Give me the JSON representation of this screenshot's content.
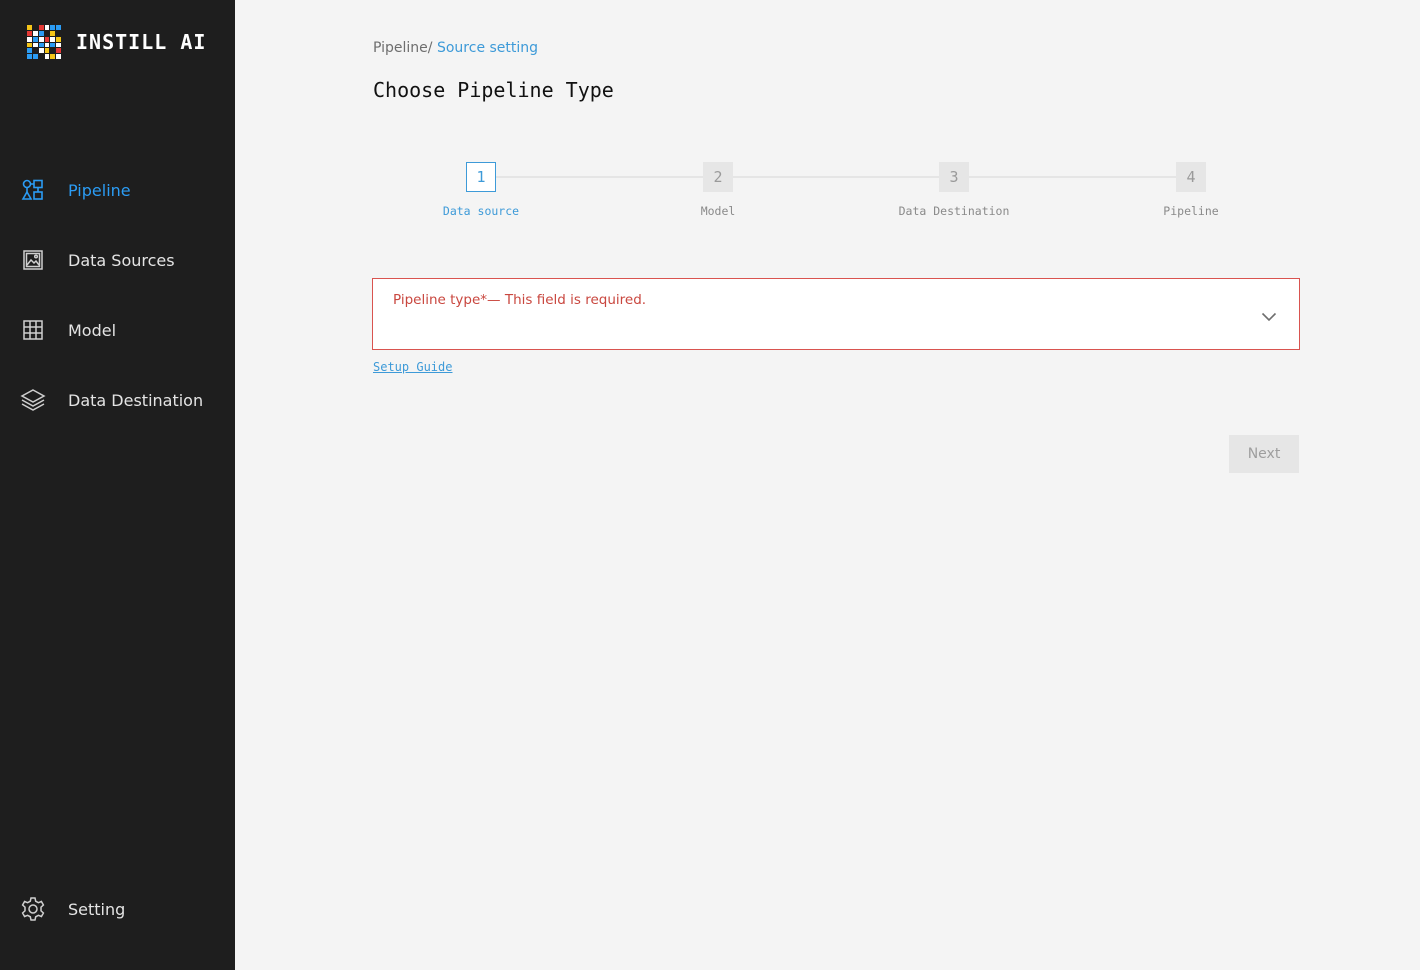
{
  "brand": {
    "name": "INSTILL AI",
    "logo_colors": [
      "#f5c518",
      "#e53935",
      "#2b9cf4",
      "#ffffff"
    ]
  },
  "sidebar": {
    "items": [
      {
        "label": "Pipeline",
        "icon": "pipeline-icon",
        "active": true
      },
      {
        "label": "Data Sources",
        "icon": "image-icon",
        "active": false
      },
      {
        "label": "Model",
        "icon": "grid-icon",
        "active": false
      },
      {
        "label": "Data Destination",
        "icon": "layers-icon",
        "active": false
      }
    ],
    "footer": {
      "label": "Setting",
      "icon": "gear-icon"
    }
  },
  "breadcrumb": {
    "parent": "Pipeline/",
    "current": "Source setting"
  },
  "page_title": "Choose Pipeline Type",
  "stepper": {
    "steps": [
      {
        "number": "1",
        "label": "Data source",
        "active": true
      },
      {
        "number": "2",
        "label": "Model",
        "active": false
      },
      {
        "number": "3",
        "label": "Data Destination",
        "active": false
      },
      {
        "number": "4",
        "label": "Pipeline",
        "active": false
      }
    ]
  },
  "form": {
    "pipeline_type_label": "Pipeline type*— This field is required.",
    "setup_guide_link": "Setup Guide",
    "next_button": "Next"
  },
  "colors": {
    "accent": "#2b9cf4",
    "link": "#3d9ad8",
    "error": "#d9534f",
    "sidebar_bg": "#1e1e1e",
    "page_bg": "#f4f4f4"
  }
}
